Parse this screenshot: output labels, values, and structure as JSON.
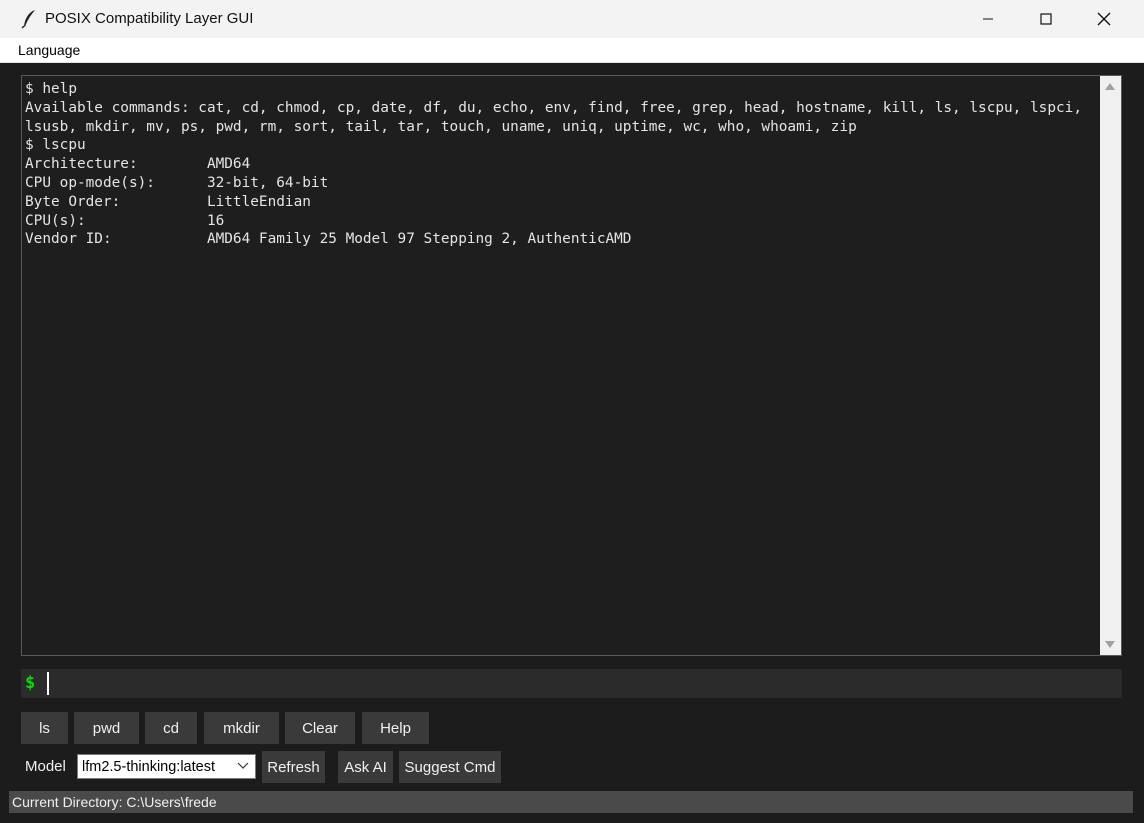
{
  "window": {
    "title": "POSIX Compatibility Layer GUI"
  },
  "menubar": {
    "items": [
      {
        "label": "Language"
      }
    ]
  },
  "terminal": {
    "lines": [
      "$ help",
      "Available commands: cat, cd, chmod, cp, date, df, du, echo, env, find, free, grep, head, hostname, kill, ls, lscpu, lspci,",
      "lsusb, mkdir, mv, ps, pwd, rm, sort, tail, tar, touch, uname, uniq, uptime, wc, who, whoami, zip",
      "$ lscpu",
      "Architecture:        AMD64",
      "CPU op-mode(s):      32-bit, 64-bit",
      "Byte Order:          LittleEndian",
      "CPU(s):              16",
      "Vendor ID:           AMD64 Family 25 Model 97 Stepping 2, AuthenticAMD"
    ]
  },
  "command_input": {
    "prompt": "$",
    "value": ""
  },
  "quick_buttons": {
    "ls": "ls",
    "pwd": "pwd",
    "cd": "cd",
    "mkdir": "mkdir",
    "clear": "Clear",
    "help": "Help"
  },
  "model_row": {
    "label": "Model",
    "selected": "lfm2.5-thinking:latest",
    "refresh": "Refresh",
    "ask_ai": "Ask AI",
    "suggest": "Suggest Cmd"
  },
  "status": {
    "text": "Current Directory: C:\\Users\\frede"
  },
  "colors": {
    "prompt": "#00e000",
    "terminal_bg": "#1e1e1e",
    "button_bg": "#3a3a3a"
  },
  "icons": {
    "app": "feather-icon",
    "minimize": "minimize-icon",
    "maximize": "maximize-icon",
    "close": "close-icon",
    "dropdown": "chevron-down-icon"
  }
}
